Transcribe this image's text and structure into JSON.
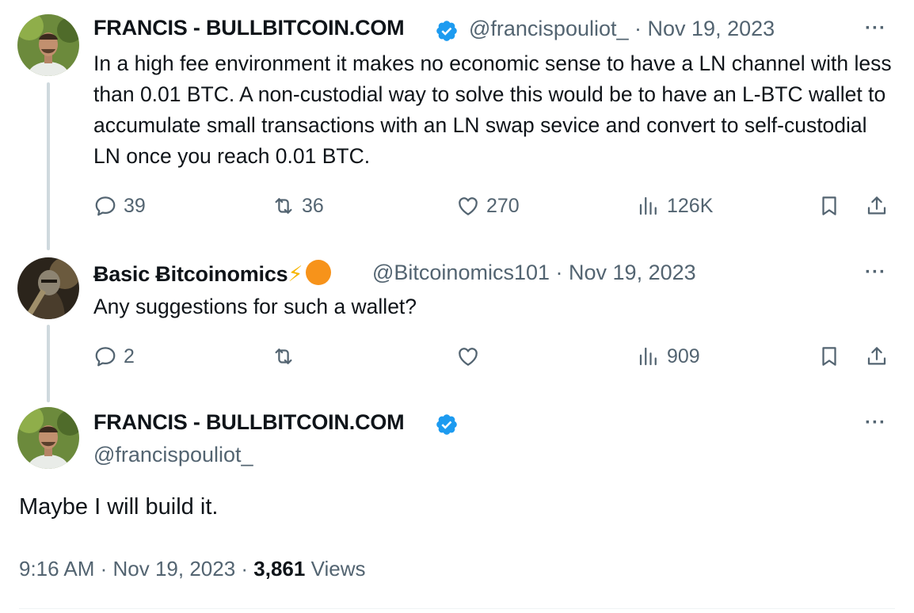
{
  "tweets": [
    {
      "author": "FRANCIS - BULLBITCOIN.COM",
      "handle": "@francispouliot_",
      "date": "· Nov 19, 2023",
      "text": "In a high fee environment it makes no economic sense to have a LN channel with less than 0.01 BTC. A non-custodial way to solve this would be to have an L-BTC wallet to accumulate small transactions with an LN swap sevice and convert to self-custodial LN once you reach 0.01 BTC.",
      "replies": "39",
      "reposts": "36",
      "likes": "270",
      "views": "126K",
      "more": "···"
    },
    {
      "author": "Ƀasic Ƀitcoinomics",
      "author_emoji": "⚡",
      "handle": "@Bitcoinomics101",
      "date": "· Nov 19, 2023",
      "text": "Any suggestions for such a wallet?",
      "replies": "2",
      "reposts": "",
      "likes": "",
      "views": "909",
      "more": "···"
    }
  ],
  "main": {
    "author": "FRANCIS - BULLBITCOIN.COM",
    "handle": "@francispouliot_",
    "text": "Maybe I will build it.",
    "time": "9:16 AM · Nov 19, 2023 · ",
    "views_count": "3,861",
    "views_label": " Views",
    "more": "···"
  },
  "colors": {
    "verified": "#1d9bf0",
    "secondary_text": "#536471",
    "thread_line": "#cfd9de"
  },
  "icons": {
    "reply": "reply-icon",
    "repost": "repost-icon",
    "like": "heart-icon",
    "views": "views-icon",
    "bookmark": "bookmark-icon",
    "share": "share-icon",
    "verified": "verified-badge-icon"
  }
}
